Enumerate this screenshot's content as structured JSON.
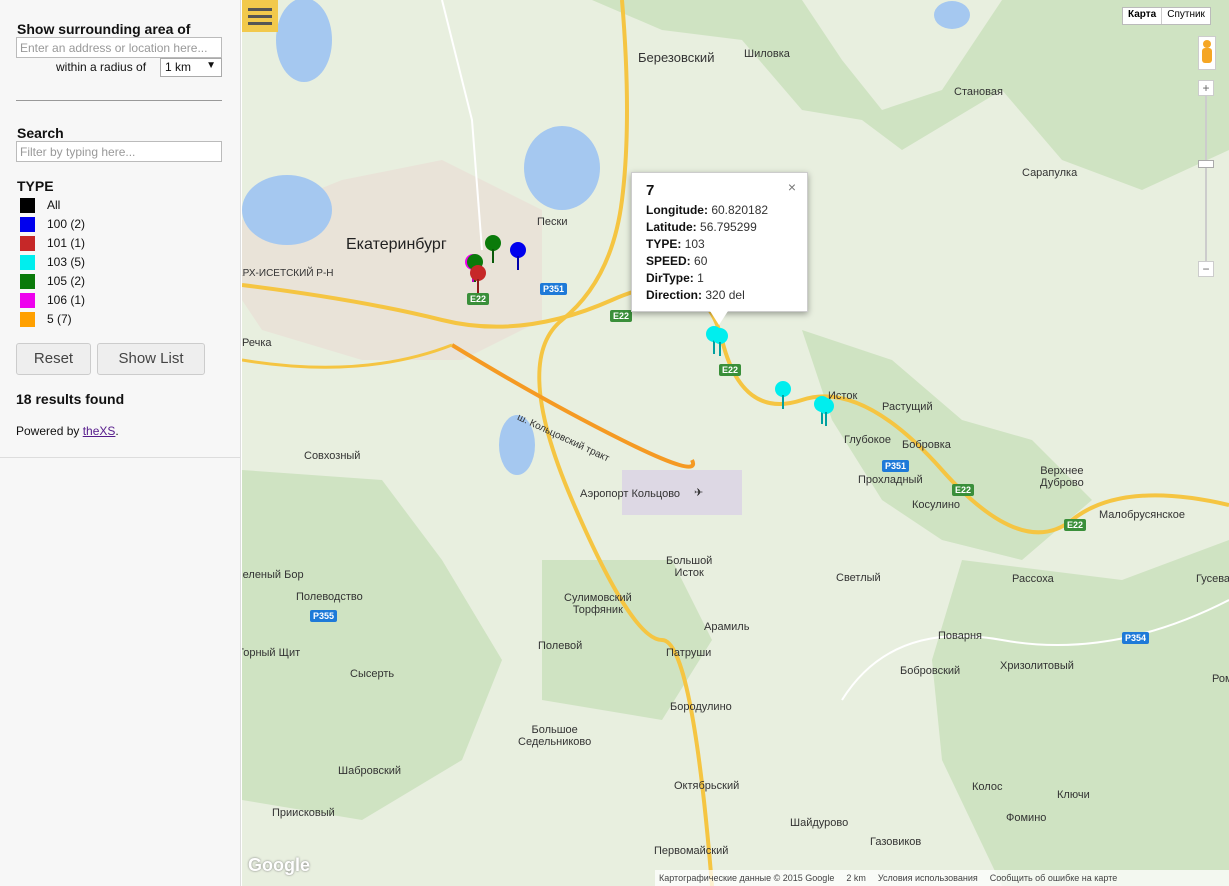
{
  "sidebar": {
    "surrounding_title": "Show surrounding area of",
    "address_placeholder": "Enter an address or location here...",
    "radius_label": "within a radius of",
    "radius_value": "1 km",
    "search_title": "Search",
    "search_placeholder": "Filter by typing here...",
    "type_title": "TYPE",
    "types": [
      {
        "label": "All",
        "color": "#000000"
      },
      {
        "label": "100 (2)",
        "color": "#0000ee"
      },
      {
        "label": "101 (1)",
        "color": "#c62828"
      },
      {
        "label": "103 (5)",
        "color": "#00eeee"
      },
      {
        "label": "105 (2)",
        "color": "#0a7a0a"
      },
      {
        "label": "106 (1)",
        "color": "#ee00ee"
      },
      {
        "label": "5 (7)",
        "color": "#ffa000"
      }
    ],
    "reset_label": "Reset",
    "show_list_label": "Show List",
    "results_text": "18 results found",
    "powered_prefix": "Powered by",
    "powered_link": "theXS",
    "powered_suffix": "."
  },
  "map": {
    "maptype_map": "Карта",
    "maptype_satellite": "Спутник",
    "labels": {
      "berezovsky": "Березовский",
      "shilovka": "Шиловка",
      "stanovaya": "Становая",
      "sarapulka": "Сарапулка",
      "peski": "Пески",
      "ekaterinburg": "Екатеринбург",
      "verkh_isetsky": "ЕРХ-ИСЕТСКИЙ Р-Н",
      "rechka": "Речка",
      "istok": "Исток",
      "rastushchiy": "Растущий",
      "glubokoe": "Глубокое",
      "bobrovka": "Бобровка",
      "prokhladny": "Прохладный",
      "verkhnee_dubrovo": "Верхнее\nДуброво",
      "kosulino": "Косулино",
      "malobrusyanskoe": "Малобрусянское",
      "sovkhozny": "Совхозный",
      "koltsovo_airport": "Аэропорт Кольцово",
      "koltsovsky_trakt": "ш. Кольцовский тракт",
      "bolshoy_istok": "Большой\nИсток",
      "svetly": "Светлый",
      "raskha": "Рассоха",
      "guseva": "Гусева",
      "zeleny_bor": "Зеленый Бор",
      "polevodstvo": "Полеводство",
      "sulimovsky_torfyanik": "Сулимовский\nТорфяник",
      "aramil": "Арамиль",
      "povarnya": "Поварня",
      "gorny_shchit": "Горный Щит",
      "polevoy": "Полевой",
      "patrushi": "Патруши",
      "bobrovsky": "Бобровский",
      "khrizolitovy": "Хризолитовый",
      "sysert": "Сысерть",
      "borodulino": "Бородулино",
      "bolshoe_sedelnikovo": "Большое\nСедельниково",
      "shabrovsky": "Шабровский",
      "oktyabrsky": "Октябрьский",
      "kolos": "Колос",
      "klyuchi": "Ключи",
      "priiskovy": "Приисковый",
      "shaidurovo": "Шайдурово",
      "fomino": "Фомино",
      "gazovikov": "Газовиков",
      "pervomaisky": "Первомайский",
      "roma": "Рома"
    },
    "shields": {
      "e22": "E22",
      "p351": "Р351",
      "p355": "Р355",
      "p354": "Р354"
    },
    "popup": {
      "title": "7",
      "longitude_label": "Longitude:",
      "longitude_value": "60.820182",
      "latitude_label": "Latitude:",
      "latitude_value": "56.795299",
      "type_label": "TYPE:",
      "type_value": "103",
      "speed_label": "SPEED:",
      "speed_value": "60",
      "dirtype_label": "DirType:",
      "dirtype_value": "1",
      "direction_label": "Direction:",
      "direction_value": "320 del",
      "close_icon": "×"
    },
    "footer": {
      "map_data": "Картографические данные © 2015 Google",
      "scale": "2 km",
      "terms": "Условия использования",
      "report": "Сообщить об ошибке на карте"
    },
    "google_logo": "Google"
  }
}
